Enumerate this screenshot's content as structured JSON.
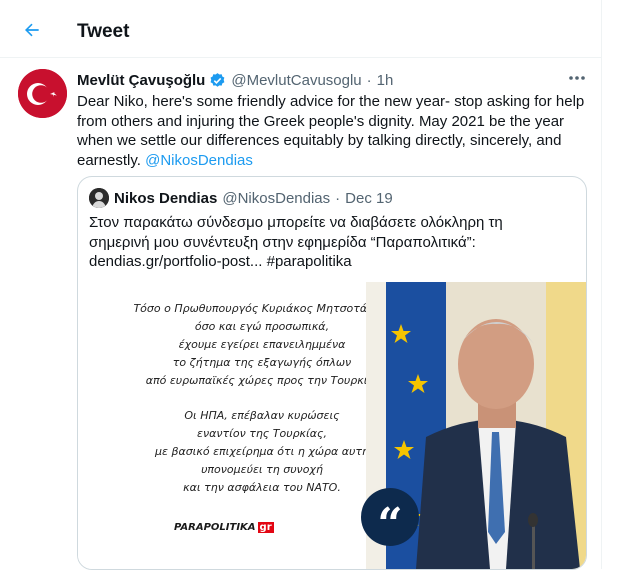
{
  "header": {
    "title": "Tweet",
    "back_icon": "arrow-left-icon"
  },
  "tweet": {
    "display_name": "Mevlüt Çavuşoğlu",
    "verified": true,
    "handle": "@MevlutCavusoglu",
    "separator": "·",
    "time": "1h",
    "text_lines": [
      "Dear Niko, here's some friendly advice for the new year- stop asking for help",
      "from others and injuring the Greek people's dignity. May 2021 be the year",
      "when we settle our differences equitably by talking directly, sincerely, and",
      "earnestly."
    ],
    "mention": "@NikosDendias"
  },
  "quoted_tweet": {
    "display_name": "Nikos Dendias",
    "handle": "@NikosDendias",
    "separator": "·",
    "date": "Dec 19",
    "text_lines": [
      "Στον παρακάτω σύνδεσμο μπορείτε να διαβάσετε ολόκληρη τη",
      "σημερινή μου συνέντευξη στην εφημερίδα “Παραπολιτικά”:",
      "dendias.gr/portfolio-post... #parapolitika"
    ],
    "image": {
      "quote_lines_1": [
        "Τόσο ο Πρωθυπουργός Κυριάκος Μητσοτάκης,",
        "όσο και εγώ προσωπικά,",
        "έχουμε εγείρει επανειλημμένα",
        "το ζήτημα της εξαγωγής όπλων",
        "από ευρωπαϊκές χώρες προς την Τουρκία."
      ],
      "quote_lines_2": [
        "Οι ΗΠΑ, επέβαλαν κυρώσεις",
        "εναντίον της Τουρκίας,",
        "με βασικό επιχείρημα ότι η χώρα αυτή",
        "υπονομεύει τη συνοχή",
        "και την ασφάλεια του ΝΑΤΟ."
      ],
      "brand": "PARAPOLITIKA",
      "brand_suffix": "gr",
      "quote_mark": "“"
    }
  },
  "colors": {
    "link": "#1d9bf0",
    "muted": "#536471",
    "turkey_red": "#c8102e",
    "eu_blue": "#1b4fa0",
    "eu_star": "#f5c400"
  }
}
